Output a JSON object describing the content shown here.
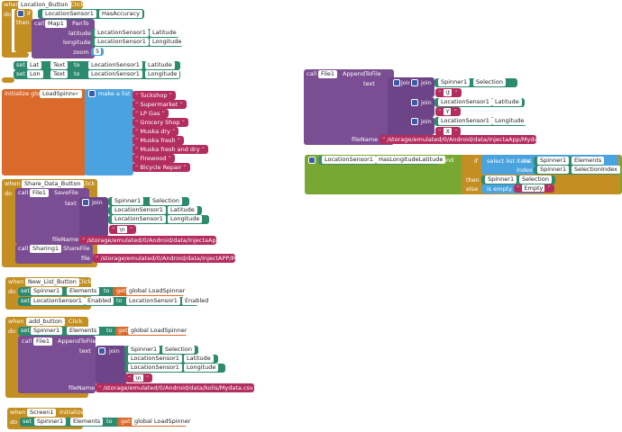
{
  "kw": {
    "when": "when",
    "do": "do",
    "then": "then",
    "else": "else",
    "if": "if",
    "call": "call",
    "set": "set",
    "to": "to",
    "get": "get",
    "join": "join",
    "make_list": "make a list",
    "initialize_global": "initialize global",
    "is_empty": "is empty",
    "select_list_item": "select list item",
    "list": "list",
    "index": "index",
    "and": "and",
    "file_name": "fileName",
    "text": "text",
    "file": "file"
  },
  "b1": {
    "component": "Location_Button",
    "event": "Click",
    "if_comp": "LocationSensor1",
    "if_prop": "HasAccuracy",
    "call_comp": "Map1",
    "call_method": "PanTo",
    "p_latitude": "latitude",
    "p_longitude": "longitude",
    "p_zoom": "zoom",
    "lat_comp": "LocationSensor1",
    "lat_prop": "Latitude",
    "lon_comp": "LocationSensor1",
    "lon_prop": "Longitude",
    "zoom_val": "5",
    "set1_comp": "Lat",
    "set1_prop": "Text",
    "set1_src": "LocationSensor1",
    "set1_srcprop": "Latitude",
    "set2_comp": "Lon",
    "set2_prop": "Text",
    "set2_src": "LocationSensor1",
    "set2_srcprop": "Longitude"
  },
  "b2": {
    "var": "LoadSpinner",
    "items": [
      "Tuckshop",
      "Supermarket",
      "LP Gas",
      "Grocery Shop",
      "Muska dry",
      "Muska fresh",
      "Muska fresh and dry",
      "Firewood",
      "Bicycle Repair"
    ]
  },
  "b3": {
    "component": "Share_Data_Button",
    "event": "Click",
    "call_comp": "File1",
    "call_method": "SaveFile",
    "j1_comp": "Spinner1",
    "j1_prop": "Selection",
    "j2_comp": "LocationSensor1",
    "j2_prop": "Latitude",
    "j3_comp": "LocationSensor1",
    "j3_prop": "Longitude",
    "j4_val": "\\n",
    "file_name": "/storage/emulated/0/Android/data/InjectaApp/Myda...",
    "share_comp": "Sharing1",
    "share_method": "ShareFile",
    "share_file": "/storage/emulated/0/Android/data/InjectAPP/Myda..."
  },
  "b4": {
    "component": "New_List_Button",
    "event": "Click",
    "set1_comp": "Spinner1",
    "set1_prop": "Elements",
    "set1_var": "global LoadSpinner",
    "set2_comp": "LocationSensor1",
    "set2_prop": "Enabled",
    "set2_src": "LocationSensor1",
    "set2_srcprop": "Enabled"
  },
  "b5": {
    "component": "add_button",
    "event": "Click",
    "set_comp": "Spinner1",
    "set_prop": "Elements",
    "set_var": "global LoadSpinner",
    "call_comp": "File1",
    "call_method": "AppendToFile",
    "j1_comp": "Spinner1",
    "j1_prop": "Selection",
    "j2_comp": "LocationSensor1",
    "j2_prop": "Latitude",
    "j3_comp": "LocationSensor1",
    "j3_prop": "Longitude",
    "j4_val": "\\n",
    "file_name": "/storage/emulated/0/Android/data/kolis/Mydata.csv"
  },
  "b6": {
    "component": "Screen1",
    "event": "Initialize",
    "set_comp": "Spinner1",
    "set_prop": "Elements",
    "set_var": "global LoadSpinner"
  },
  "b7": {
    "call_comp": "File1",
    "call_method": "AppendToFile",
    "j1_comp": "Spinner1",
    "j1_prop": "Selection",
    "j1_sep": "\\t",
    "j2_comp": "LocationSensor1",
    "j2_prop": "Latitude",
    "j2_sep": "Y",
    "j3_comp": "LocationSensor1",
    "j3_prop": "Longitude",
    "j3_sep": "X",
    "file_name": "/storage/emulated/0/Android/data/InjectaApp/Myda..."
  },
  "b8": {
    "comp": "LocationSensor1",
    "prop": "HasLongitudeLatitude",
    "list_comp": "Spinner1",
    "list_prop": "Elements",
    "index_comp": "Spinner1",
    "index_prop": "SelectionIndex",
    "then_comp": "Spinner1",
    "then_prop": "Selection",
    "else_val": "Empty"
  }
}
